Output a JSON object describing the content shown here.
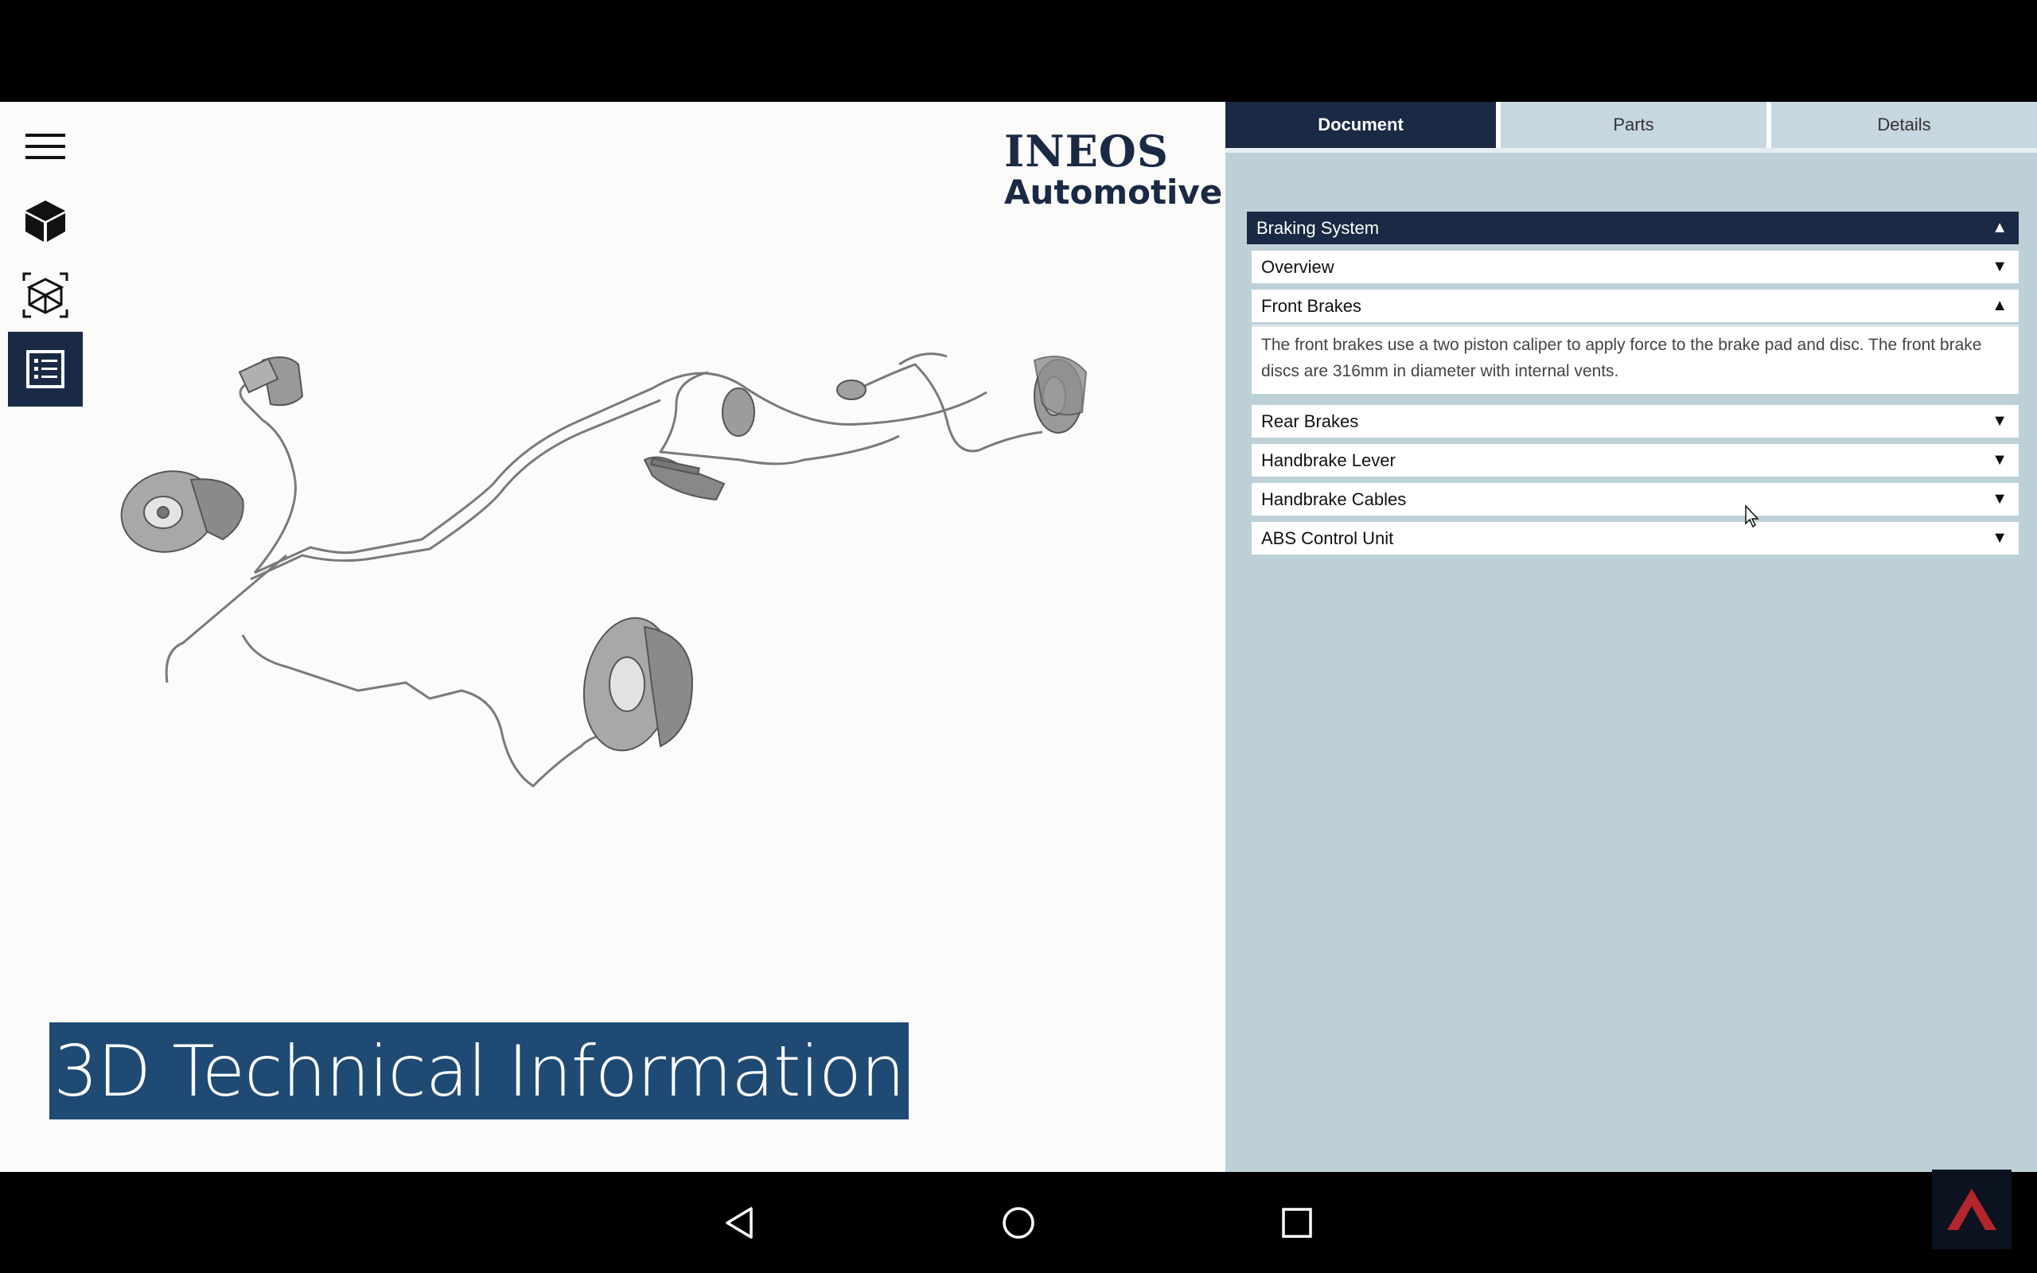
{
  "app": {
    "logo_line1": "INEOS",
    "logo_line2": "Automotive",
    "banner_title": "3D Technical Information"
  },
  "toolbar": {
    "items": [
      {
        "icon": "hamburger-menu-icon",
        "active": false
      },
      {
        "icon": "solid-cube-icon",
        "active": false
      },
      {
        "icon": "wireframe-cube-icon",
        "active": false
      },
      {
        "icon": "document-list-icon",
        "active": true
      }
    ]
  },
  "tabs": [
    {
      "label": "Document",
      "active": true
    },
    {
      "label": "Parts",
      "active": false
    },
    {
      "label": "Details",
      "active": false
    }
  ],
  "document": {
    "section_title": "Braking System",
    "items": [
      {
        "label": "Overview",
        "expanded": false
      },
      {
        "label": "Front Brakes",
        "expanded": true,
        "body": "The front brakes use a two piston caliper to apply force to the brake pad and disc. The front brake discs are 316mm in diameter with internal vents."
      },
      {
        "label": "Rear Brakes",
        "expanded": false
      },
      {
        "label": "Handbrake Lever",
        "expanded": false
      },
      {
        "label": "Handbrake Cables",
        "expanded": false
      },
      {
        "label": "ABS Control Unit",
        "expanded": false
      }
    ]
  },
  "colors": {
    "navy": "#1a2a44",
    "banner": "#1e4a73",
    "panel_bg": "#bdd0d8"
  },
  "nav": {
    "icons": [
      "back-icon",
      "home-icon",
      "recents-icon"
    ]
  }
}
